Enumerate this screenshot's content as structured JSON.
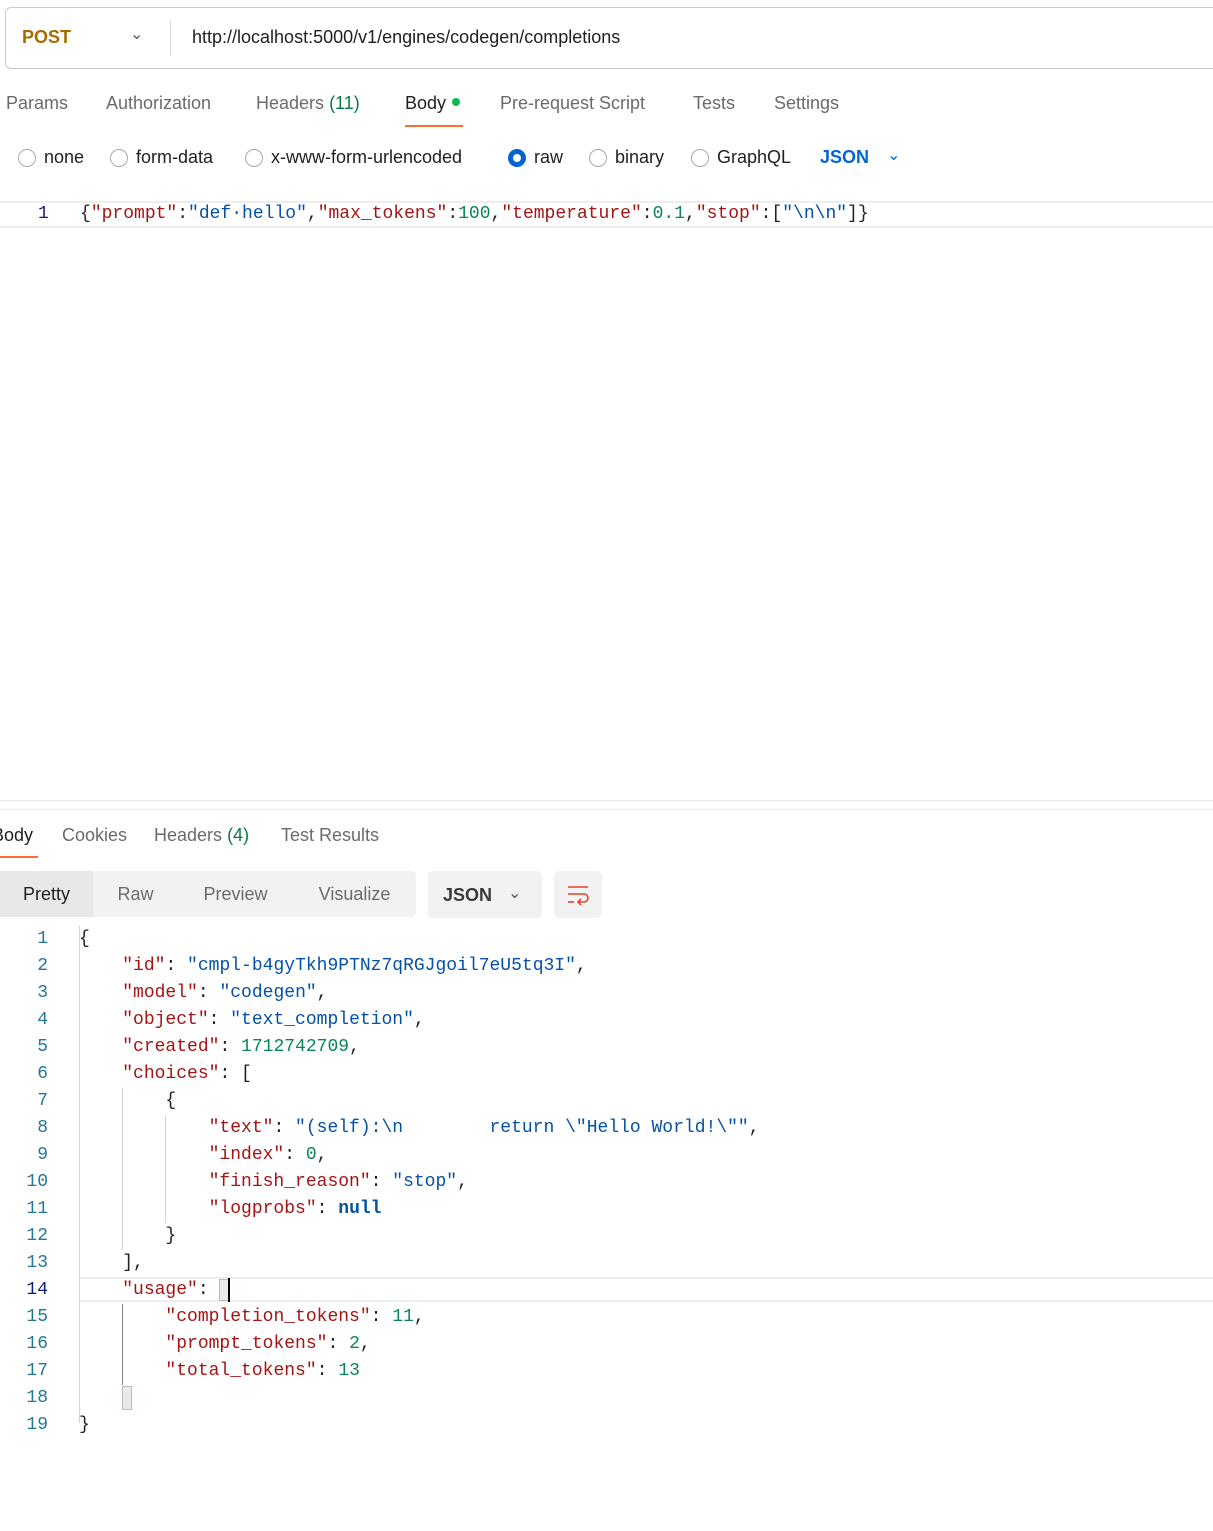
{
  "request": {
    "method": "POST",
    "url": "http://localhost:5000/v1/engines/codegen/completions"
  },
  "tabs": {
    "params": "Params",
    "authorization": "Authorization",
    "headers": "Headers",
    "headers_count": "(11)",
    "body": "Body",
    "prerequest": "Pre-request Script",
    "tests": "Tests",
    "settings": "Settings"
  },
  "body_types": {
    "none": "none",
    "form_data": "form-data",
    "urlencoded": "x-www-form-urlencoded",
    "raw": "raw",
    "binary": "binary",
    "graphql": "GraphQL",
    "selected": "raw",
    "format": "JSON"
  },
  "request_body": {
    "line_number": "1",
    "tokens": [
      [
        "p",
        "{"
      ],
      [
        "k",
        "\"prompt\""
      ],
      [
        "p",
        ":"
      ],
      [
        "s",
        "\"def·hello\""
      ],
      [
        "p",
        ","
      ],
      [
        "k",
        "\"max_tokens\""
      ],
      [
        "p",
        ":"
      ],
      [
        "n",
        "100"
      ],
      [
        "p",
        ","
      ],
      [
        "k",
        "\"temperature\""
      ],
      [
        "p",
        ":"
      ],
      [
        "n",
        "0.1"
      ],
      [
        "p",
        ","
      ],
      [
        "k",
        "\"stop\""
      ],
      [
        "p",
        ":["
      ],
      [
        "s",
        "\"\\n\\n\""
      ],
      [
        "p",
        "]}"
      ]
    ]
  },
  "response": {
    "tabs": {
      "body": "Body",
      "cookies": "Cookies",
      "headers": "Headers",
      "headers_count": "(4)",
      "test_results": "Test Results"
    },
    "views": {
      "pretty": "Pretty",
      "raw": "Raw",
      "preview": "Preview",
      "visualize": "Visualize"
    },
    "format": "JSON",
    "lines": [
      [
        [
          "p",
          "{"
        ]
      ],
      [
        [
          "p",
          "    "
        ],
        [
          "k",
          "\"id\""
        ],
        [
          "p",
          ": "
        ],
        [
          "s",
          "\"cmpl-b4gyTkh9PTNz7qRGJgoil7eU5tq3I\""
        ],
        [
          "p",
          ","
        ]
      ],
      [
        [
          "p",
          "    "
        ],
        [
          "k",
          "\"model\""
        ],
        [
          "p",
          ": "
        ],
        [
          "s",
          "\"codegen\""
        ],
        [
          "p",
          ","
        ]
      ],
      [
        [
          "p",
          "    "
        ],
        [
          "k",
          "\"object\""
        ],
        [
          "p",
          ": "
        ],
        [
          "s",
          "\"text_completion\""
        ],
        [
          "p",
          ","
        ]
      ],
      [
        [
          "p",
          "    "
        ],
        [
          "k",
          "\"created\""
        ],
        [
          "p",
          ": "
        ],
        [
          "n",
          "1712742709"
        ],
        [
          "p",
          ","
        ]
      ],
      [
        [
          "p",
          "    "
        ],
        [
          "k",
          "\"choices\""
        ],
        [
          "p",
          ": ["
        ]
      ],
      [
        [
          "p",
          "        {"
        ]
      ],
      [
        [
          "p",
          "            "
        ],
        [
          "k",
          "\"text\""
        ],
        [
          "p",
          ": "
        ],
        [
          "s",
          "\"(self):\\n        return \\\"Hello World!\\\"\""
        ],
        [
          "p",
          ","
        ]
      ],
      [
        [
          "p",
          "            "
        ],
        [
          "k",
          "\"index\""
        ],
        [
          "p",
          ": "
        ],
        [
          "n",
          "0"
        ],
        [
          "p",
          ","
        ]
      ],
      [
        [
          "p",
          "            "
        ],
        [
          "k",
          "\"finish_reason\""
        ],
        [
          "p",
          ": "
        ],
        [
          "s",
          "\"stop\""
        ],
        [
          "p",
          ","
        ]
      ],
      [
        [
          "p",
          "            "
        ],
        [
          "k",
          "\"logprobs\""
        ],
        [
          "p",
          ": "
        ],
        [
          "b",
          "null"
        ]
      ],
      [
        [
          "p",
          "        }"
        ]
      ],
      [
        [
          "p",
          "    ],"
        ]
      ],
      [
        [
          "p",
          "    "
        ],
        [
          "k",
          "\"usage\""
        ],
        [
          "p",
          ": {"
        ]
      ],
      [
        [
          "p",
          "        "
        ],
        [
          "k",
          "\"completion_tokens\""
        ],
        [
          "p",
          ": "
        ],
        [
          "n",
          "11"
        ],
        [
          "p",
          ","
        ]
      ],
      [
        [
          "p",
          "        "
        ],
        [
          "k",
          "\"prompt_tokens\""
        ],
        [
          "p",
          ": "
        ],
        [
          "n",
          "2"
        ],
        [
          "p",
          ","
        ]
      ],
      [
        [
          "p",
          "        "
        ],
        [
          "k",
          "\"total_tokens\""
        ],
        [
          "p",
          ": "
        ],
        [
          "n",
          "13"
        ]
      ],
      [
        [
          "p",
          "    }"
        ]
      ],
      [
        [
          "p",
          "}"
        ]
      ]
    ]
  },
  "colors": {
    "method": "#a36d00",
    "accent": "#ff6c37",
    "radio_selected": "#0265d2",
    "json_key": "#a31515",
    "json_string": "#0451a5",
    "json_number": "#098658"
  }
}
